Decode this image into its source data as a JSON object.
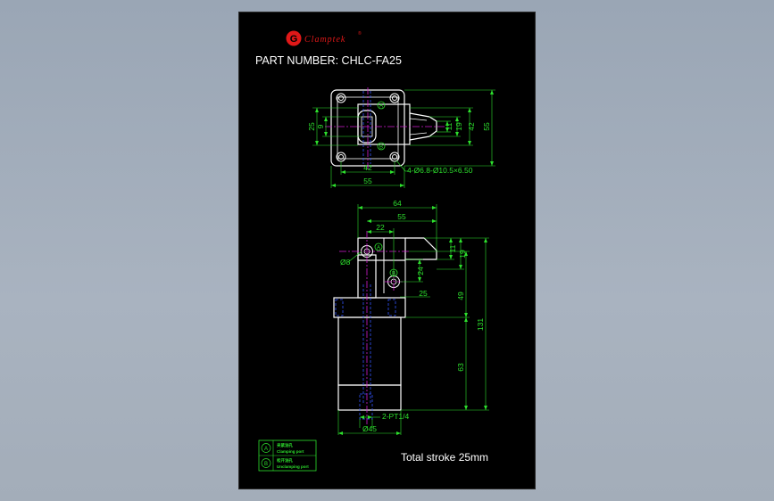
{
  "logo": {
    "text": "Clamptek",
    "registered": "®",
    "letter": "G"
  },
  "part_number": "PART NUMBER: CHLC-FA25",
  "dims_top": {
    "h25": "25",
    "h9": "9",
    "h11": "11",
    "h19": "19",
    "h42": "42",
    "h55": "55",
    "w42": "42",
    "w55": "55",
    "holes": "4-Ø6.8-Ø10.5×6.50",
    "markA": "A",
    "markB": "B"
  },
  "dims_side": {
    "w64": "64",
    "w55": "55",
    "w22": "22",
    "d8": "Ø8",
    "h24": "24",
    "h25": "25",
    "h11": "11",
    "h19": "19",
    "h49": "49",
    "h131": "131",
    "h63": "63",
    "port": "2-PT1/4",
    "d45": "Ø45",
    "markA": "A",
    "markB": "B"
  },
  "legend": {
    "items": [
      {
        "key": "A",
        "cn": "夹紧油孔",
        "en": "Clamping port"
      },
      {
        "key": "B",
        "cn": "松开油孔",
        "en": "Unclamping port"
      }
    ]
  },
  "total_stroke": "Total stroke 25mm"
}
